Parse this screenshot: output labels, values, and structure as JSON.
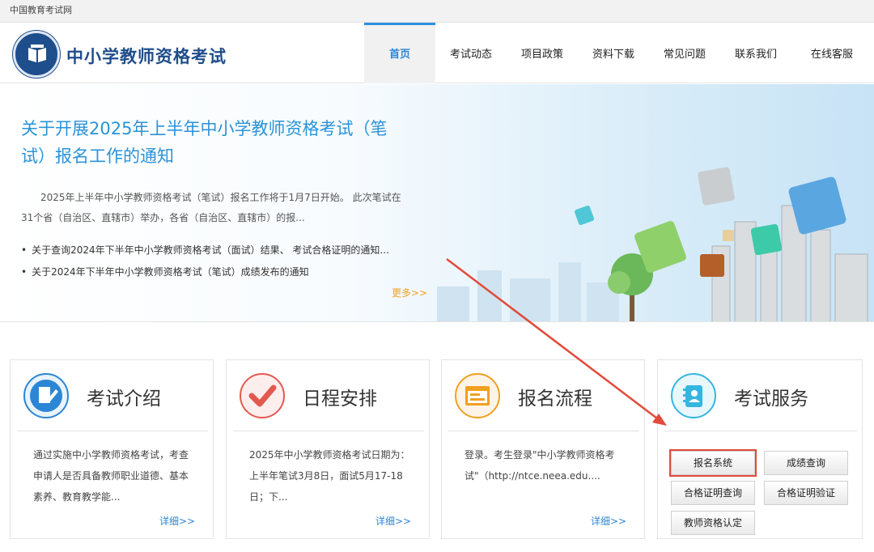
{
  "topbar": {
    "site_link": "中国教育考试网"
  },
  "header": {
    "title": "中小学教师资格考试",
    "nav": [
      {
        "label": "首页",
        "active": true
      },
      {
        "label": "考试动态"
      },
      {
        "label": "项目政策"
      },
      {
        "label": "资料下载"
      },
      {
        "label": "常见问题"
      },
      {
        "label": "联系我们"
      },
      {
        "label": "在线客服"
      }
    ]
  },
  "banner": {
    "headline": "关于开展2025年上半年中小学教师资格考试（笔试）报名工作的通知",
    "summary": "2025年上半年中小学教师资格考试（笔试）报名工作将于1月7日开始。 此次笔试在31个省（自治区、直辖市）举办，各省（自治区、直辖市）的报...",
    "news": [
      "关于查询2024年下半年中小学教师资格考试（面试）结果、 考试合格证明的通知...",
      "关于2024年下半年中小学教师资格考试（笔试）成绩发布的通知"
    ],
    "more": "更多>>"
  },
  "cards": [
    {
      "title": "考试介绍",
      "icon": "document-pen-icon",
      "body": "通过实施中小学教师资格考试，考查申请人是否具备教师职业道德、基本素养、教育教学能...",
      "more": "详细>>"
    },
    {
      "title": "日程安排",
      "icon": "checkmark-icon",
      "body": "2025年中小学教师资格考试日期为：上半年笔试3月8日，面试5月17-18日；下...",
      "more": "详细>>"
    },
    {
      "title": "报名流程",
      "icon": "browser-form-icon",
      "body": "登录。考生登录\"中小学教师资格考试\"（http://ntce.neea.edu....",
      "more": "详细>>"
    },
    {
      "title": "考试服务",
      "icon": "contact-book-icon"
    }
  ],
  "services": [
    {
      "label": "报名系统",
      "highlighted": true
    },
    {
      "label": "成绩查询"
    },
    {
      "label": "合格证明查询"
    },
    {
      "label": "合格证明验证"
    },
    {
      "label": "教师资格认定"
    }
  ],
  "colors": {
    "accent": "#2b86d6",
    "brand": "#1f4d8a",
    "more": "#f0a020",
    "highlight": "#e24a3b"
  }
}
